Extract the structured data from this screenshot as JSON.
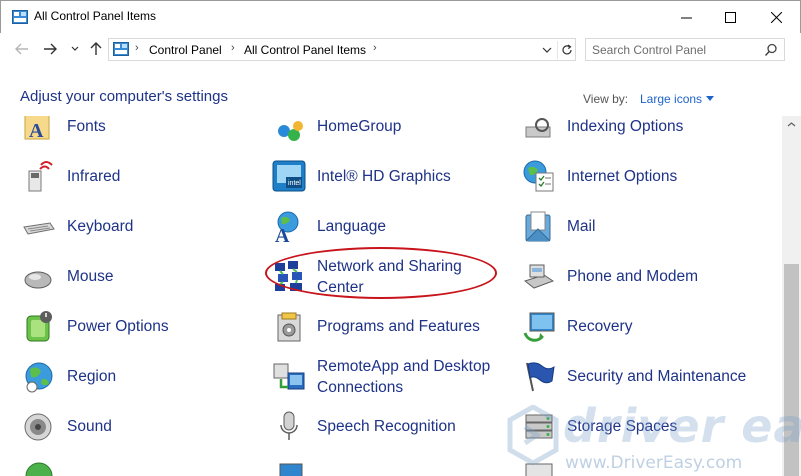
{
  "window": {
    "title": "All Control Panel Items"
  },
  "address": {
    "crumbs": [
      "Control Panel",
      "All Control Panel Items"
    ]
  },
  "search": {
    "placeholder": "Search Control Panel"
  },
  "header": {
    "heading": "Adjust your computer's settings",
    "view_by_label": "View by:",
    "view_by_value": "Large icons"
  },
  "items": [
    {
      "label": "Fonts",
      "icon": "fonts-icon"
    },
    {
      "label": "HomeGroup",
      "icon": "homegroup-icon"
    },
    {
      "label": "Indexing Options",
      "icon": "indexing-options-icon"
    },
    {
      "label": "Infrared",
      "icon": "infrared-icon"
    },
    {
      "label": "Intel® HD Graphics",
      "icon": "intel-graphics-icon"
    },
    {
      "label": "Internet Options",
      "icon": "internet-options-icon"
    },
    {
      "label": "Keyboard",
      "icon": "keyboard-icon"
    },
    {
      "label": "Language",
      "icon": "language-icon"
    },
    {
      "label": "Mail",
      "icon": "mail-icon"
    },
    {
      "label": "Mouse",
      "icon": "mouse-icon"
    },
    {
      "label_line1": "Network and Sharing",
      "label_line2": "Center",
      "icon": "network-sharing-icon"
    },
    {
      "label": "Phone and Modem",
      "icon": "phone-modem-icon"
    },
    {
      "label": "Power Options",
      "icon": "power-options-icon"
    },
    {
      "label": "Programs and Features",
      "icon": "programs-features-icon"
    },
    {
      "label": "Recovery",
      "icon": "recovery-icon"
    },
    {
      "label": "Region",
      "icon": "region-icon"
    },
    {
      "label_line1": "RemoteApp and Desktop",
      "label_line2": "Connections",
      "icon": "remoteapp-icon"
    },
    {
      "label": "Security and Maintenance",
      "icon": "security-flag-icon"
    },
    {
      "label": "Sound",
      "icon": "sound-icon"
    },
    {
      "label": "Speech Recognition",
      "icon": "microphone-icon"
    },
    {
      "label": "Storage Spaces",
      "icon": "storage-spaces-icon"
    }
  ],
  "watermark": {
    "brand": "driver easy",
    "url": "www.DriverEasy.com"
  },
  "colors": {
    "link": "#1e3287",
    "accent": "#1e64c8",
    "highlight": "#c8141c"
  }
}
